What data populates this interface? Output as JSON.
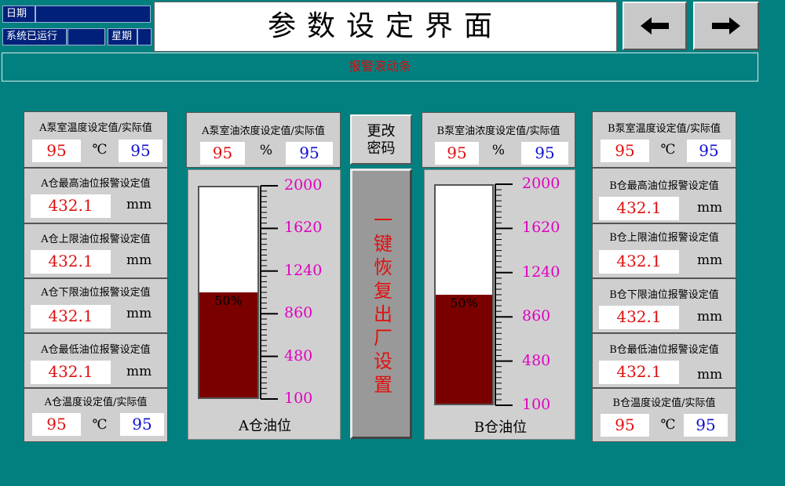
{
  "header": {
    "date_label": "日期",
    "runtime_label": "系统已运行",
    "weekday_label": "星期",
    "title": "参数设定界面",
    "prev_icon": "arrow-left-icon",
    "next_icon": "arrow-right-icon"
  },
  "alarm_marquee": "报警滚动条",
  "left": {
    "pump_temp": {
      "label": "A泵室温度设定值/实际值",
      "set": "95",
      "unit": "℃",
      "actual": "95"
    },
    "max_level": {
      "label": "A仓最高油位报警设定值",
      "value": "432.1",
      "unit": "mm"
    },
    "upper_level": {
      "label": "A仓上限油位报警设定值",
      "value": "432.1",
      "unit": "mm"
    },
    "lower_level": {
      "label": "A仓下限油位报警设定值",
      "value": "432.1",
      "unit": "mm"
    },
    "min_level": {
      "label": "A仓最低油位报警设定值",
      "value": "432.1",
      "unit": "mm"
    },
    "tank_temp": {
      "label": "A仓温度设定值/实际值",
      "set": "95",
      "unit": "℃",
      "actual": "95"
    }
  },
  "gauge_a": {
    "conc_label": "A泵室油浓度设定值/实际值",
    "set": "95",
    "unit": "%",
    "actual": "95",
    "level_fraction": 0.5,
    "pct_label": "50%",
    "caption": "A仓油位",
    "ticks": [
      "2000",
      "1620",
      "1240",
      "860",
      "480",
      "100"
    ]
  },
  "center": {
    "change_pwd": "更改密码",
    "factory_reset": "一键恢复出厂设置"
  },
  "gauge_b": {
    "conc_label": "B泵室油浓度设定值/实际值",
    "set": "95",
    "unit": "%",
    "actual": "95",
    "level_fraction": 0.5,
    "pct_label": "50%",
    "caption": "B仓油位",
    "ticks": [
      "2000",
      "1620",
      "1240",
      "860",
      "480",
      "100"
    ]
  },
  "right": {
    "pump_temp": {
      "label": "B泵室温度设定值/实际值",
      "set": "95",
      "unit": "℃",
      "actual": "95"
    },
    "max_level": {
      "label": "B仓最高油位报警设定值",
      "value": "432.1",
      "unit": "mm"
    },
    "upper_level": {
      "label": "B仓上限油位报警设定值",
      "value": "432.1",
      "unit": "mm"
    },
    "lower_level": {
      "label": "B仓下限油位报警设定值",
      "value": "432.1",
      "unit": "mm"
    },
    "min_level": {
      "label": "B仓最低油位报警设定值",
      "value": "432.1",
      "unit": "mm"
    },
    "tank_temp": {
      "label": "B仓温度设定值/实际值",
      "set": "95",
      "unit": "℃",
      "actual": "95"
    }
  },
  "colors": {
    "background": "#028080",
    "fill": "#7a0000",
    "setpoint": "#e01010",
    "actual": "#1010d0",
    "scale_label": "#e000c0"
  }
}
